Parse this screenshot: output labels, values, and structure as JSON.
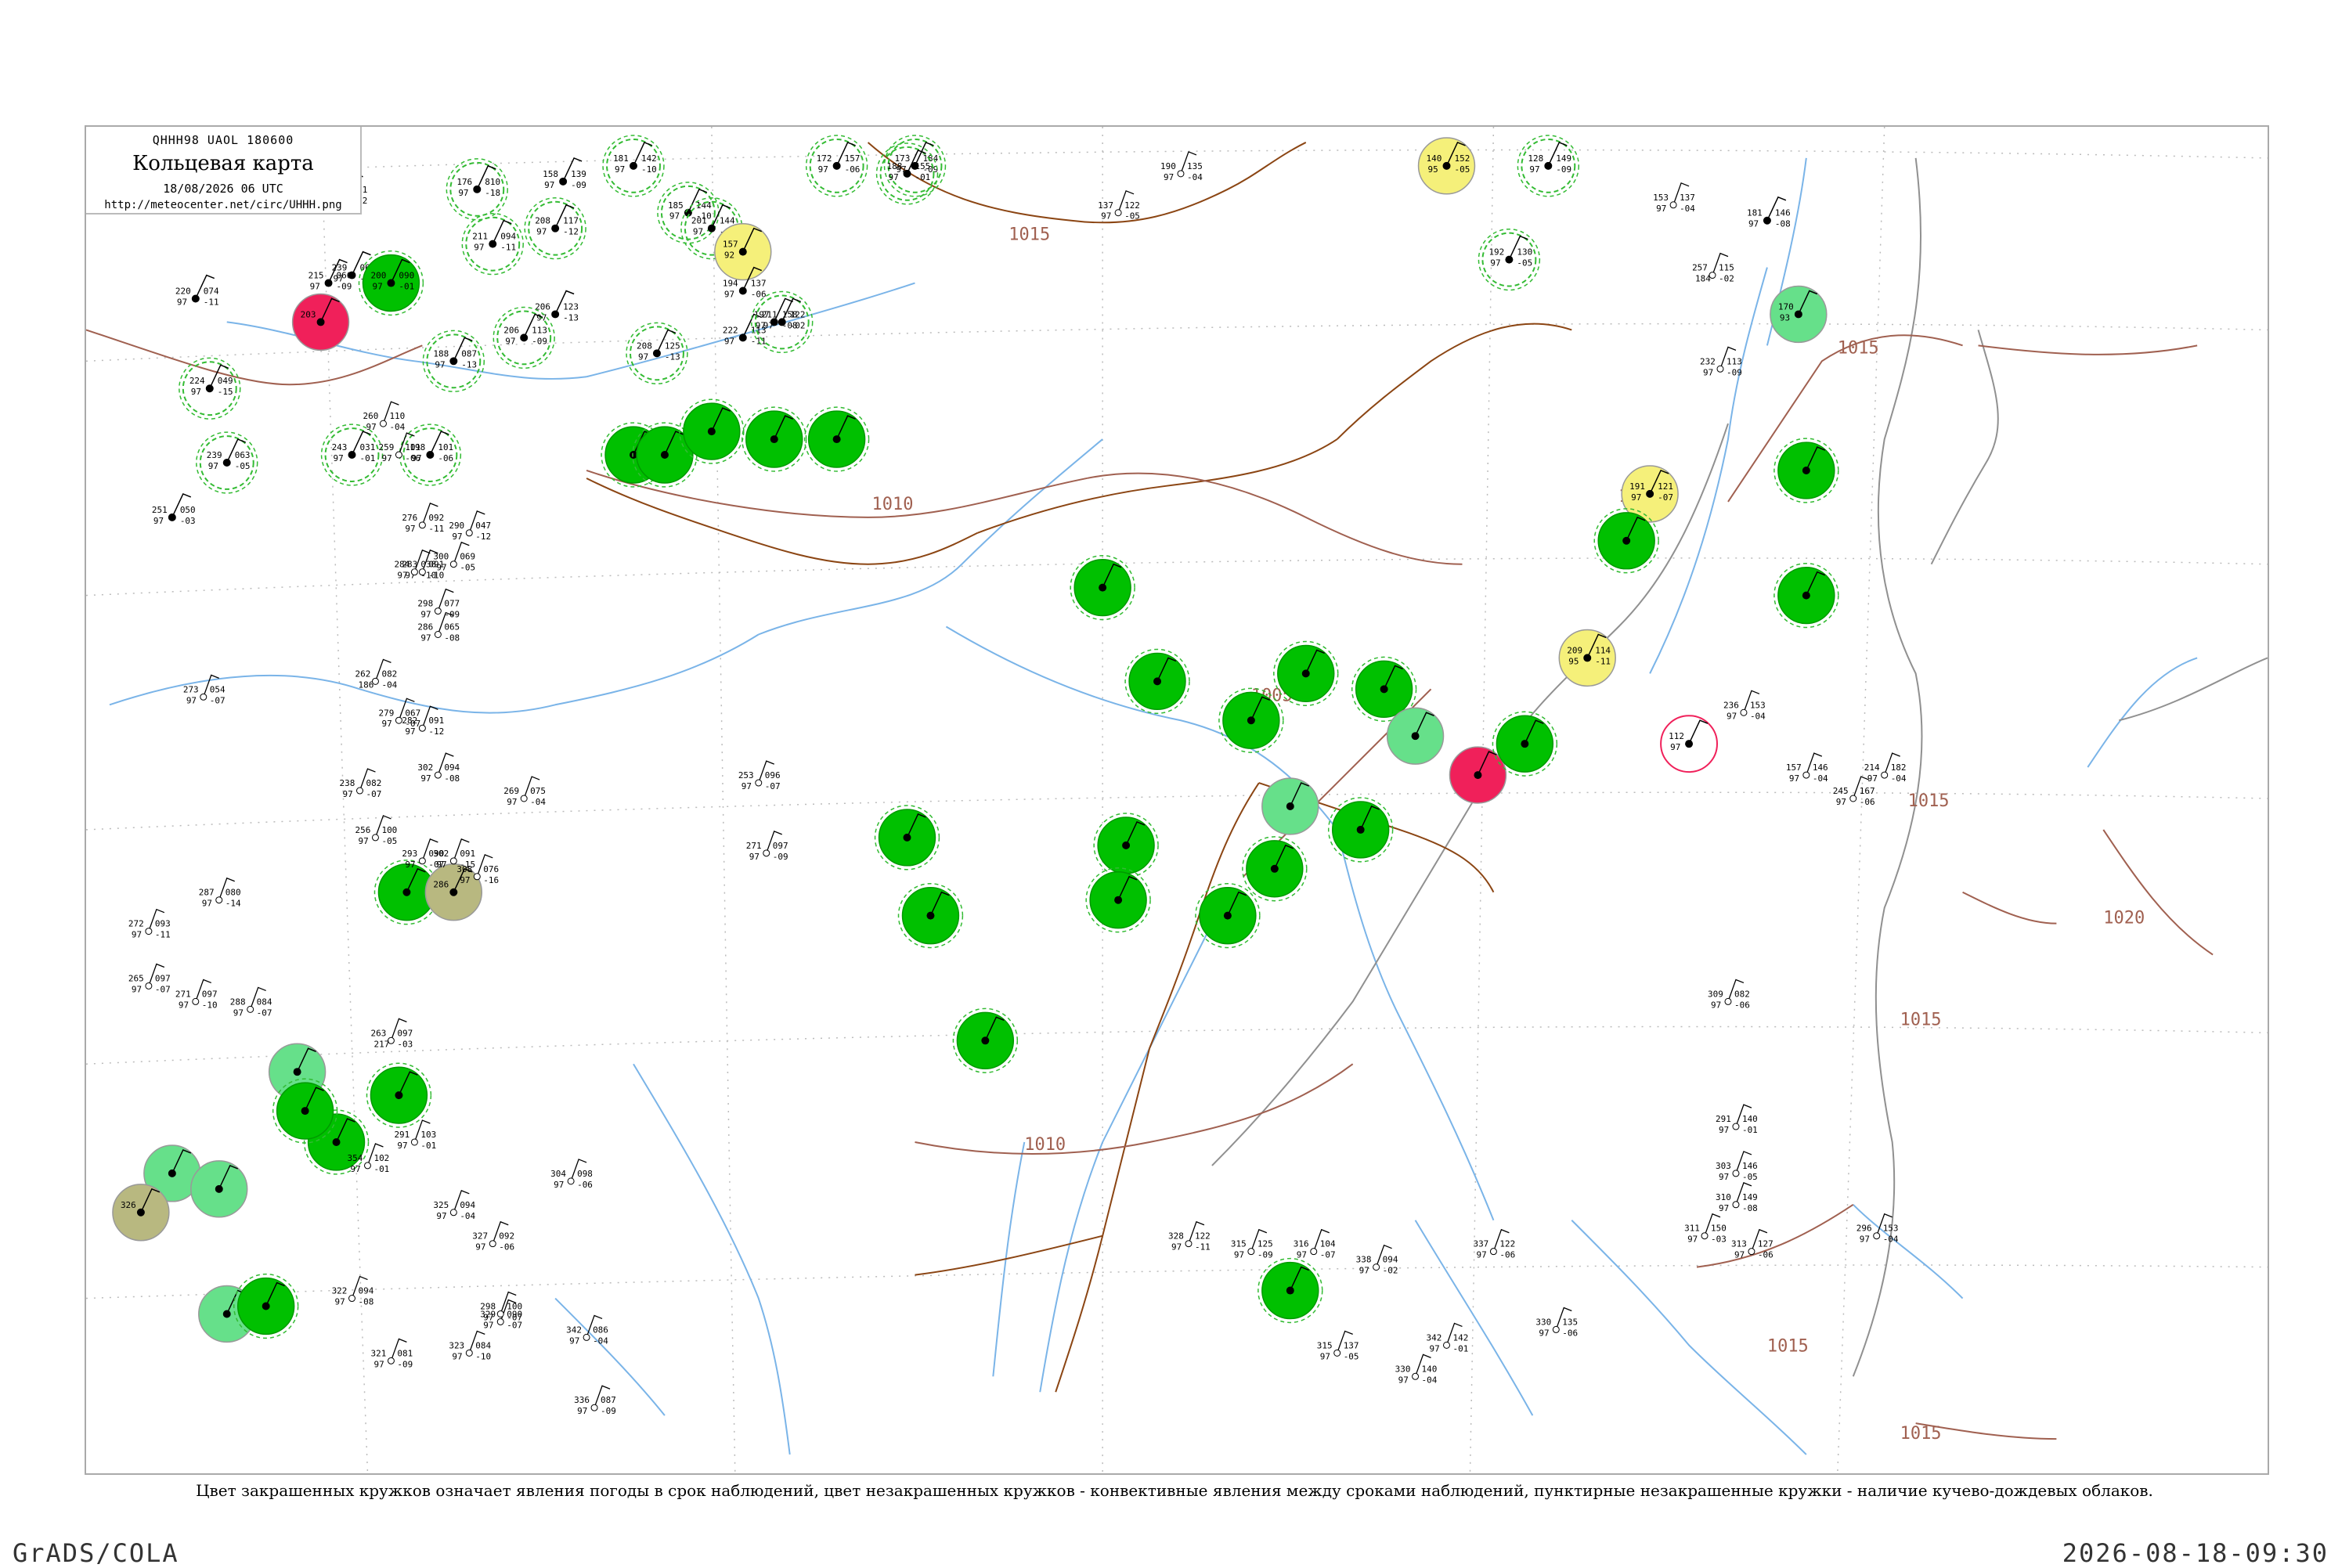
{
  "header": {
    "code": "QHHH98  UAOL  180600",
    "title": "Кольцевая карта",
    "date": "18/08/2026 06 UTC",
    "url": "http://meteocenter.net/circ/UHHH.png"
  },
  "caption": "Цвет закрашенных кружков означает явления погоды в срок наблюдений, цвет незакрашенных кружков - конвективные явления между сроками наблюдений, пунктирные незакрашенные кружки - наличие кучево-дождевых облаков.",
  "footer": {
    "left": "GrADS/COLA",
    "right": "2026-08-18-09:30"
  },
  "colors": {
    "rain": "#00c000",
    "light_rain": "#66e08a",
    "thunder": "#f0205a",
    "fog": "#f5f07a",
    "haze": "#b8b880",
    "cb_dash": "#33bb33",
    "river": "#7ab4e8",
    "coast": "#909090",
    "isobar": "#a06050",
    "grid": "#bbbbbb",
    "border": "#8b4513"
  },
  "isobars": [
    {
      "label": "1015"
    },
    {
      "label": "1010"
    },
    {
      "label": "1005"
    },
    {
      "label": "1010"
    },
    {
      "label": "1015"
    },
    {
      "label": "1010"
    },
    {
      "label": "1015"
    },
    {
      "label": "1020"
    },
    {
      "label": "1015"
    },
    {
      "label": "1015"
    },
    {
      "label": "1015"
    }
  ],
  "stations": [
    {
      "t": "222",
      "p": "091",
      "q": "72",
      "d": "-12",
      "kind": "none"
    },
    {
      "t": "158",
      "p": "139",
      "q": "97",
      "d": "-09",
      "kind": "none"
    },
    {
      "t": "176",
      "p": "810",
      "q": "97",
      "d": "-18",
      "kind": "cb"
    },
    {
      "t": "239",
      "p": "064",
      "q": "97",
      "d": "-12",
      "kind": "none"
    },
    {
      "t": "200",
      "p": "090",
      "q": "97",
      "d": "-01",
      "kind": "rain"
    },
    {
      "t": "215",
      "p": "066",
      "q": "97",
      "d": "-09",
      "kind": "none"
    },
    {
      "t": "220",
      "p": "074",
      "q": "97",
      "d": "-11",
      "kind": "none"
    },
    {
      "t": "224",
      "p": "049",
      "q": "97",
      "d": "-15",
      "kind": "cb"
    },
    {
      "t": "239",
      "p": "063",
      "q": "97",
      "d": "-05",
      "kind": "cb"
    },
    {
      "t": "251",
      "p": "050",
      "q": "97",
      "d": "-03",
      "kind": "none"
    },
    {
      "t": "203",
      "p": "",
      "q": "",
      "d": "",
      "kind": "thunder"
    },
    {
      "t": "208",
      "p": "117",
      "q": "97",
      "d": "-12",
      "kind": "cb"
    },
    {
      "t": "211",
      "p": "094",
      "q": "97",
      "d": "-11",
      "kind": "cb"
    },
    {
      "t": "206",
      "p": "123",
      "q": "97",
      "d": "-13",
      "kind": "none"
    },
    {
      "t": "206",
      "p": "113",
      "q": "97",
      "d": "-09",
      "kind": "cb"
    },
    {
      "t": "208",
      "p": "125",
      "q": "97",
      "d": "-13",
      "kind": "cb"
    },
    {
      "t": "198",
      "p": "101",
      "q": "97",
      "d": "-06",
      "kind": "cb"
    },
    {
      "t": "188",
      "p": "087",
      "q": "97",
      "d": "-13",
      "kind": "cb"
    },
    {
      "t": "243",
      "p": "031",
      "q": "97",
      "d": "-01",
      "kind": "cb"
    },
    {
      "t": "181",
      "p": "142",
      "q": "97",
      "d": "-10",
      "kind": "cb"
    },
    {
      "t": "185",
      "p": "144",
      "q": "97",
      "d": "-10",
      "kind": "cb"
    },
    {
      "t": "201",
      "p": "144",
      "q": "97",
      "d": "-09",
      "kind": "cb"
    },
    {
      "t": "157",
      "p": "",
      "q": "92",
      "d": "",
      "kind": "fog"
    },
    {
      "t": "194",
      "p": "137",
      "q": "97",
      "d": "-06",
      "kind": "none"
    },
    {
      "t": "197",
      "p": "158",
      "q": "97",
      "d": "-08",
      "kind": "none"
    },
    {
      "t": "222",
      "p": "113",
      "q": "97",
      "d": "-11",
      "kind": "none"
    },
    {
      "t": "211",
      "p": "122",
      "q": "97",
      "d": "-02",
      "kind": "cb"
    },
    {
      "t": "",
      "p": "",
      "q": "",
      "d": "",
      "kind": "rain"
    },
    {
      "t": "",
      "p": "",
      "q": "",
      "d": "",
      "kind": "rain"
    },
    {
      "t": "",
      "p": "",
      "q": "",
      "d": "",
      "kind": "rain"
    },
    {
      "t": "172",
      "p": "157",
      "q": "97",
      "d": "-06",
      "kind": "cb"
    },
    {
      "t": "173",
      "p": "184",
      "q": "97",
      "d": "-09",
      "kind": "cb"
    },
    {
      "t": "188",
      "p": "155",
      "q": "97",
      "d": "-01",
      "kind": "cb"
    },
    {
      "t": "140",
      "p": "152",
      "q": "95",
      "d": "-05",
      "kind": "fog"
    },
    {
      "t": "128",
      "p": "149",
      "q": "97",
      "d": "-09",
      "kind": "cb"
    },
    {
      "t": "192",
      "p": "130",
      "q": "97",
      "d": "-05",
      "kind": "cb"
    },
    {
      "t": "181",
      "p": "146",
      "q": "97",
      "d": "-08",
      "kind": "none"
    },
    {
      "t": "170",
      "p": "",
      "q": "93",
      "d": "",
      "kind": "lightrain"
    },
    {
      "t": "191",
      "p": "121",
      "q": "97",
      "d": "-07",
      "kind": "fog"
    },
    {
      "t": "",
      "p": "",
      "q": "",
      "d": "",
      "kind": "rain"
    },
    {
      "t": "209",
      "p": "114",
      "q": "95",
      "d": "-11",
      "kind": "fog"
    },
    {
      "t": "",
      "p": "",
      "q": "",
      "d": "",
      "kind": "thunder"
    },
    {
      "t": "",
      "p": "",
      "q": "",
      "d": "",
      "kind": "rain"
    },
    {
      "t": "112",
      "p": "",
      "q": "97",
      "d": "",
      "kind": "thunderring"
    },
    {
      "t": "",
      "p": "",
      "q": "",
      "d": "",
      "kind": "rain"
    },
    {
      "t": "",
      "p": "",
      "q": "",
      "d": "",
      "kind": "rain"
    },
    {
      "t": "",
      "p": "",
      "q": "",
      "d": "",
      "kind": "rain"
    },
    {
      "t": "",
      "p": "",
      "q": "",
      "d": "",
      "kind": "rain"
    },
    {
      "t": "",
      "p": "",
      "q": "",
      "d": "",
      "kind": "rain"
    },
    {
      "t": "",
      "p": "",
      "q": "",
      "d": "",
      "kind": "rain"
    },
    {
      "t": "",
      "p": "",
      "q": "",
      "d": "",
      "kind": "rain"
    },
    {
      "t": "",
      "p": "",
      "q": "",
      "d": "",
      "kind": "rain"
    },
    {
      "t": "",
      "p": "",
      "q": "",
      "d": "",
      "kind": "rain"
    },
    {
      "t": "",
      "p": "",
      "q": "",
      "d": "",
      "kind": "rain"
    },
    {
      "t": "",
      "p": "",
      "q": "",
      "d": "",
      "kind": "lightrain"
    },
    {
      "t": "",
      "p": "",
      "q": "",
      "d": "",
      "kind": "lightrain"
    },
    {
      "t": "",
      "p": "",
      "q": "",
      "d": "",
      "kind": "rain"
    },
    {
      "t": "",
      "p": "",
      "q": "",
      "d": "",
      "kind": "rain"
    },
    {
      "t": "",
      "p": "",
      "q": "",
      "d": "",
      "kind": "rain"
    },
    {
      "t": "",
      "p": "",
      "q": "",
      "d": "",
      "kind": "rain"
    },
    {
      "t": "",
      "p": "",
      "q": "",
      "d": "",
      "kind": "rain"
    },
    {
      "t": "",
      "p": "",
      "q": "",
      "d": "",
      "kind": "rain"
    },
    {
      "t": "286",
      "p": "",
      "q": "",
      "d": "",
      "kind": "haze"
    },
    {
      "t": "",
      "p": "",
      "q": "",
      "d": "",
      "kind": "lightrain"
    },
    {
      "t": "326",
      "p": "",
      "q": "",
      "d": "",
      "kind": "haze"
    },
    {
      "t": "",
      "p": "",
      "q": "",
      "d": "",
      "kind": "lightrain"
    },
    {
      "t": "",
      "p": "",
      "q": "",
      "d": "",
      "kind": "lightrain"
    },
    {
      "t": "",
      "p": "",
      "q": "",
      "d": "",
      "kind": "rain"
    },
    {
      "t": "",
      "p": "",
      "q": "",
      "d": "",
      "kind": "lightrain"
    },
    {
      "t": "",
      "p": "",
      "q": "",
      "d": "",
      "kind": "rain"
    },
    {
      "t": "",
      "p": "",
      "q": "",
      "d": "",
      "kind": "rain"
    },
    {
      "t": "",
      "p": "",
      "q": "",
      "d": "",
      "kind": "rain"
    },
    {
      "t": "",
      "p": "",
      "q": "",
      "d": "",
      "kind": "rain"
    },
    {
      "t": "",
      "p": "",
      "q": "",
      "d": "",
      "kind": "rain"
    },
    {
      "t": "",
      "p": "",
      "q": "",
      "d": "",
      "kind": "rain"
    }
  ],
  "plain_stations": [
    {
      "a": "190",
      "b": "135",
      "c": "97",
      "d": "-04"
    },
    {
      "a": "137",
      "b": "122",
      "c": "97",
      "d": "-05"
    },
    {
      "a": "236",
      "b": "153",
      "c": "97",
      "d": "-04"
    },
    {
      "a": "157",
      "b": "146",
      "c": "97",
      "d": "-04"
    },
    {
      "a": "257",
      "b": "115",
      "c": "184",
      "d": "-02"
    },
    {
      "a": "153",
      "b": "137",
      "c": "97",
      "d": "-04"
    },
    {
      "a": "232",
      "b": "113",
      "c": "97",
      "d": "-09"
    },
    {
      "a": "214",
      "b": "182",
      "c": "97",
      "d": "-04"
    },
    {
      "a": "245",
      "b": "167",
      "c": "97",
      "d": "-06"
    },
    {
      "a": "260",
      "b": "110",
      "c": "97",
      "d": "-04"
    },
    {
      "a": "259",
      "b": "101",
      "c": "97",
      "d": "-06"
    },
    {
      "a": "276",
      "b": "092",
      "c": "97",
      "d": "-11"
    },
    {
      "a": "283",
      "b": "091",
      "c": "97",
      "d": "-10"
    },
    {
      "a": "298",
      "b": "077",
      "c": "97",
      "d": "-09"
    },
    {
      "a": "262",
      "b": "082",
      "c": "186",
      "d": "-04"
    },
    {
      "a": "282",
      "b": "091",
      "c": "97",
      "d": "-12"
    },
    {
      "a": "302",
      "b": "094",
      "c": "97",
      "d": "-08"
    },
    {
      "a": "273",
      "b": "054",
      "c": "97",
      "d": "-07"
    },
    {
      "a": "300",
      "b": "069",
      "c": "97",
      "d": "-05"
    },
    {
      "a": "290",
      "b": "047",
      "c": "97",
      "d": "-12"
    },
    {
      "a": "284",
      "b": "038",
      "c": "97",
      "d": "-10"
    },
    {
      "a": "286",
      "b": "065",
      "c": "97",
      "d": "-08"
    },
    {
      "a": "279",
      "b": "067",
      "c": "97",
      "d": "-07"
    },
    {
      "a": "238",
      "b": "082",
      "c": "97",
      "d": "-07"
    },
    {
      "a": "256",
      "b": "100",
      "c": "97",
      "d": "-05"
    },
    {
      "a": "269",
      "b": "075",
      "c": "97",
      "d": "-04"
    },
    {
      "a": "253",
      "b": "096",
      "c": "97",
      "d": "-07"
    },
    {
      "a": "271",
      "b": "097",
      "c": "97",
      "d": "-09"
    },
    {
      "a": "302",
      "b": "091",
      "c": "97",
      "d": "-15"
    },
    {
      "a": "293",
      "b": "090",
      "c": "97",
      "d": "-07"
    },
    {
      "a": "308",
      "b": "076",
      "c": "97",
      "d": "-16"
    },
    {
      "a": "287",
      "b": "080",
      "c": "97",
      "d": "-14"
    },
    {
      "a": "272",
      "b": "093",
      "c": "97",
      "d": "-11"
    },
    {
      "a": "265",
      "b": "097",
      "c": "97",
      "d": "-07"
    },
    {
      "a": "271",
      "b": "097",
      "c": "97",
      "d": "-10"
    },
    {
      "a": "288",
      "b": "084",
      "c": "97",
      "d": "-07"
    },
    {
      "a": "263",
      "b": "097",
      "c": "217",
      "d": "-03"
    },
    {
      "a": "291",
      "b": "103",
      "c": "97",
      "d": "-01"
    },
    {
      "a": "354",
      "b": "102",
      "c": "97",
      "d": "-01"
    },
    {
      "a": "322",
      "b": "094",
      "c": "97",
      "d": "-08"
    },
    {
      "a": "325",
      "b": "094",
      "c": "97",
      "d": "-04"
    },
    {
      "a": "327",
      "b": "092",
      "c": "97",
      "d": "-06"
    },
    {
      "a": "329",
      "b": "090",
      "c": "97",
      "d": "-07"
    },
    {
      "a": "342",
      "b": "086",
      "c": "97",
      "d": "-04"
    },
    {
      "a": "336",
      "b": "087",
      "c": "97",
      "d": "-09"
    },
    {
      "a": "321",
      "b": "081",
      "c": "97",
      "d": "-09"
    },
    {
      "a": "323",
      "b": "084",
      "c": "97",
      "d": "-10"
    },
    {
      "a": "298",
      "b": "100",
      "c": "97",
      "d": "-07"
    },
    {
      "a": "304",
      "b": "098",
      "c": "97",
      "d": "-06"
    },
    {
      "a": "309",
      "b": "082",
      "c": "97",
      "d": "-06"
    },
    {
      "a": "291",
      "b": "140",
      "c": "97",
      "d": "-01"
    },
    {
      "a": "303",
      "b": "146",
      "c": "97",
      "d": "-05"
    },
    {
      "a": "310",
      "b": "149",
      "c": "97",
      "d": "-08"
    },
    {
      "a": "311",
      "b": "150",
      "c": "97",
      "d": "-03"
    },
    {
      "a": "296",
      "b": "153",
      "c": "97",
      "d": "-04"
    },
    {
      "a": "313",
      "b": "127",
      "c": "97",
      "d": "-06"
    },
    {
      "a": "328",
      "b": "122",
      "c": "97",
      "d": "-11"
    },
    {
      "a": "315",
      "b": "125",
      "c": "97",
      "d": "-09"
    },
    {
      "a": "316",
      "b": "104",
      "c": "97",
      "d": "-07"
    },
    {
      "a": "338",
      "b": "094",
      "c": "97",
      "d": "-02"
    },
    {
      "a": "337",
      "b": "122",
      "c": "97",
      "d": "-06"
    },
    {
      "a": "342",
      "b": "142",
      "c": "97",
      "d": "-01"
    },
    {
      "a": "315",
      "b": "137",
      "c": "97",
      "d": "-05"
    },
    {
      "a": "330",
      "b": "140",
      "c": "97",
      "d": "-04"
    },
    {
      "a": "330",
      "b": "135",
      "c": "97",
      "d": "-06"
    }
  ]
}
